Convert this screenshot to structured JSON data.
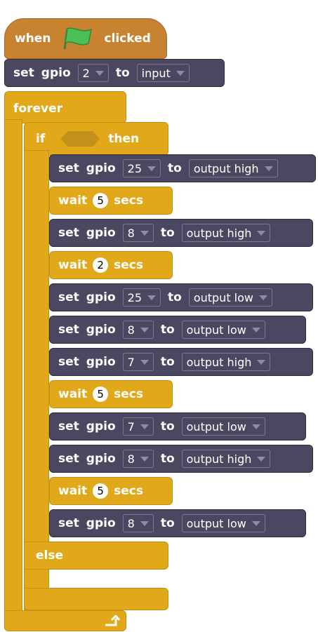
{
  "hat": {
    "when": "when",
    "clicked": "clicked"
  },
  "setup": {
    "set": "set",
    "gpio": "gpio",
    "pin": "2",
    "to": "to",
    "mode": "input"
  },
  "forever": {
    "label": "forever"
  },
  "if_block": {
    "if": "if",
    "then": "then",
    "else": "else"
  },
  "body": [
    {
      "type": "gpio",
      "set": "set",
      "gpio": "gpio",
      "pin": "25",
      "to": "to",
      "mode": "output high"
    },
    {
      "type": "wait",
      "wait": "wait",
      "secs_value": "5",
      "secs": "secs"
    },
    {
      "type": "gpio",
      "set": "set",
      "gpio": "gpio",
      "pin": "8",
      "to": "to",
      "mode": "output high"
    },
    {
      "type": "wait",
      "wait": "wait",
      "secs_value": "2",
      "secs": "secs"
    },
    {
      "type": "gpio",
      "set": "set",
      "gpio": "gpio",
      "pin": "25",
      "to": "to",
      "mode": "output low"
    },
    {
      "type": "gpio",
      "set": "set",
      "gpio": "gpio",
      "pin": "8",
      "to": "to",
      "mode": "output low"
    },
    {
      "type": "gpio",
      "set": "set",
      "gpio": "gpio",
      "pin": "7",
      "to": "to",
      "mode": "output high"
    },
    {
      "type": "wait",
      "wait": "wait",
      "secs_value": "5",
      "secs": "secs"
    },
    {
      "type": "gpio",
      "set": "set",
      "gpio": "gpio",
      "pin": "7",
      "to": "to",
      "mode": "output low"
    },
    {
      "type": "gpio",
      "set": "set",
      "gpio": "gpio",
      "pin": "8",
      "to": "to",
      "mode": "output high"
    },
    {
      "type": "wait",
      "wait": "wait",
      "secs_value": "5",
      "secs": "secs"
    },
    {
      "type": "gpio",
      "set": "set",
      "gpio": "gpio",
      "pin": "8",
      "to": "to",
      "mode": "output low"
    }
  ],
  "colors": {
    "events": "#C88330",
    "control": "#E1A91A",
    "extension": "#4A4860",
    "flag": "#4CBF56"
  },
  "icons": {
    "flag": "green-flag-icon",
    "loop": "loop-arrow-icon"
  }
}
